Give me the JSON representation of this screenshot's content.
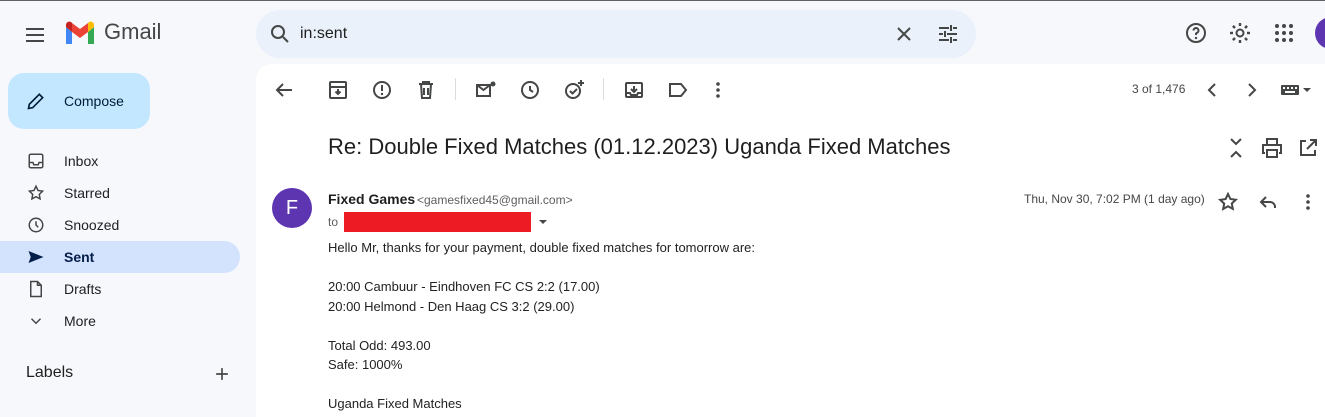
{
  "app": {
    "name": "Gmail"
  },
  "search": {
    "value": "in:sent"
  },
  "compose": {
    "label": "Compose"
  },
  "sidebar": {
    "items": [
      {
        "label": "Inbox",
        "icon": "inbox-icon"
      },
      {
        "label": "Starred",
        "icon": "star-icon"
      },
      {
        "label": "Snoozed",
        "icon": "clock-icon"
      },
      {
        "label": "Sent",
        "icon": "send-icon",
        "active": true
      },
      {
        "label": "Drafts",
        "icon": "draft-icon"
      },
      {
        "label": "More",
        "icon": "chevron-down-icon"
      }
    ],
    "labels_heading": "Labels"
  },
  "toolbar": {
    "pager": "3 of 1,476"
  },
  "message": {
    "subject": "Re: Double Fixed Matches (01.12.2023) Uganda Fixed Matches",
    "avatar_letter": "F",
    "sender_name": "Fixed Games",
    "sender_email": "<gamesfixed45@gmail.com>",
    "to_label": "to",
    "date": "Thu, Nov 30, 7:02 PM (1 day ago)",
    "body_lines": [
      "Hello Mr, thanks for your payment, double fixed matches for tomorrow are:",
      "",
      "20:00 Cambuur - Eindhoven FC CS 2:2 (17.00)",
      "20:00 Helmond - Den Haag CS 3:2 (29.00)",
      "",
      "Total Odd: 493.00",
      "Safe: 1000%",
      "",
      "Uganda Fixed Matches"
    ]
  },
  "colors": {
    "accent": "#c2e7ff",
    "active_nav": "#d3e3fd",
    "avatar": "#5e35b1",
    "redaction": "#ed1c24"
  }
}
